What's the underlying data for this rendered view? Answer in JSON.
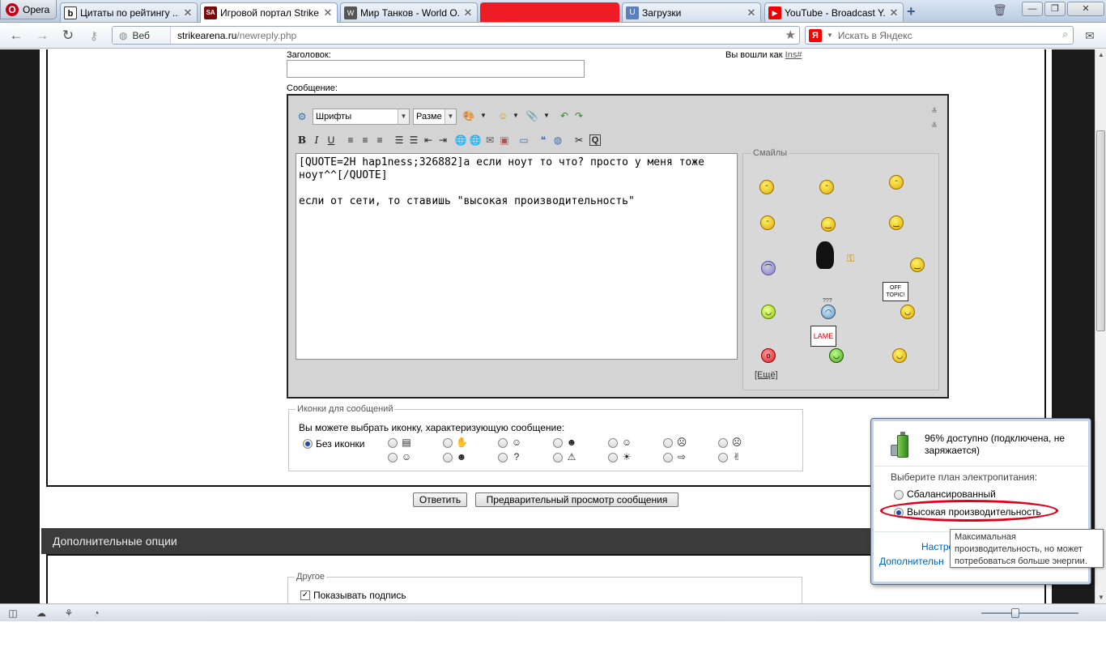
{
  "browser": {
    "opera_label": "Opera",
    "tabs": [
      {
        "title": "Цитаты по рейтингу ....",
        "fav": "b",
        "fav_color": "#1a1a1a"
      },
      {
        "title": "Игровой портал Strike...",
        "fav": "SA",
        "fav_color": "#8b0000"
      },
      {
        "title": "Мир Танков - World O...",
        "fav": "W",
        "fav_color": "#4d4d4d"
      },
      {
        "title": "",
        "fav": "",
        "fav_color": "#ee1c25"
      },
      {
        "title": "Загрузки",
        "fav": "U",
        "fav_color": "#4a6ea8"
      },
      {
        "title": "YouTube - Broadcast Y...",
        "fav": "▶",
        "fav_color": "#e00000"
      }
    ],
    "site_label": "Веб",
    "url_domain": "strikearena.ru",
    "url_path": "/newreply.php",
    "search_placeholder": "Искать в Яндекс",
    "yandex_glyph": "Я"
  },
  "form": {
    "title_label": "Заголовок:",
    "logged_in_text": "Вы вошли как",
    "logged_in_user": "Ins#",
    "message_label": "Сообщение:",
    "font_select": "Шрифты",
    "size_select": "Разме",
    "message_lines": [
      "[QUOTE=2H hap1ness;326882]а если ноут то что? просто у меня тоже",
      "ноут^^[/QUOTE]",
      "",
      "если от сети, то ставишь \"высокая производительность\""
    ],
    "smilies_legend": "Смайлы",
    "smilies_more": "[Ещё]",
    "smilies_off_topic": "OFF TOPIC!",
    "smilies_lame": "LAME",
    "smilies_question": "???",
    "icons_legend": "Иконки для сообщений",
    "icons_prompt": "Вы можете выбрать иконку, характеризующую сообщение:",
    "no_icon_label": "Без иконки",
    "reply_button": "Ответить",
    "preview_button": "Предварительный просмотр сообщения",
    "extra_options_header": "Дополнительные опции",
    "other_legend": "Другое",
    "show_signature_label": "Показывать подпись"
  },
  "power_flyout": {
    "status_text": "96% доступно (подключена, не заряжается)",
    "battery_percent": 96,
    "choose_plan": "Выберите план электропитания:",
    "plan_balanced": "Сбалансированный",
    "plan_high": "Высокая производительность",
    "selected_plan": "plan_high",
    "link_settings": "Настро",
    "link_more": "Дополнительн",
    "tooltip": "Максимальная производительность, но может потребоваться больше энергии.",
    "highlight_color": "#e0001b"
  },
  "zoom_level": 0.35
}
